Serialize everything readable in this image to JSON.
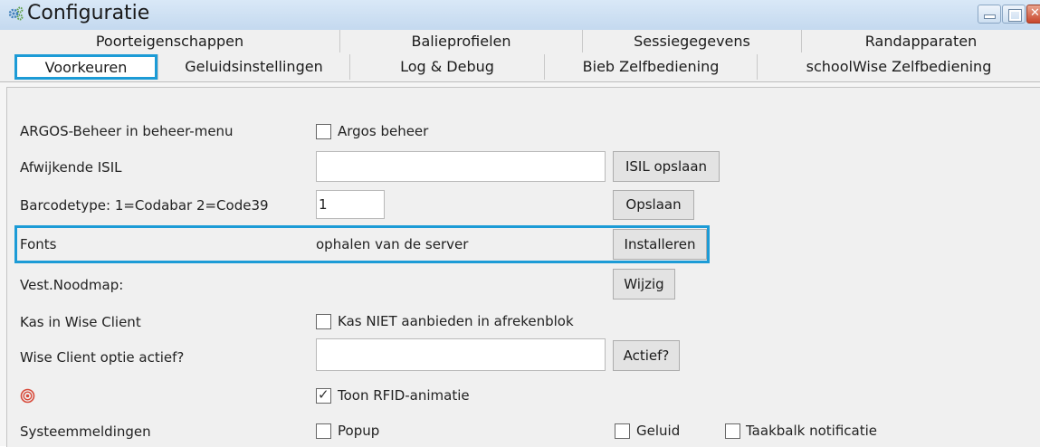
{
  "window": {
    "title": "Configuratie",
    "icon": "gears-icon",
    "controls": [
      "minimize",
      "maximize",
      "close"
    ]
  },
  "tabs": {
    "row1": [
      "Poorteigenschappen",
      "Balieprofielen",
      "Sessiegegevens",
      "Randapparaten"
    ],
    "row2": [
      "Voorkeuren",
      "Geluidsinstellingen",
      "Log & Debug",
      "Bieb Zelfbediening",
      "schoolWise Zelfbediening"
    ],
    "active": "Voorkeuren"
  },
  "settings": {
    "argos": {
      "label": "ARGOS-Beheer in beheer-menu",
      "checkbox": "Argos beheer",
      "checked": false
    },
    "isil": {
      "label": "Afwijkende ISIL",
      "value": "",
      "button": "ISIL opslaan"
    },
    "barcode": {
      "label": "Barcodetype: 1=Codabar 2=Code39",
      "value": "1",
      "button": "Opslaan"
    },
    "fonts": {
      "label": "Fonts",
      "info": "ophalen van de server",
      "button": "Installeren"
    },
    "noodmap": {
      "label": "Vest.Noodmap:",
      "button": "Wijzig"
    },
    "kas": {
      "label": "Kas in Wise Client",
      "checkbox": "Kas NIET aanbieden in afrekenblok",
      "checked": false
    },
    "wiseclient": {
      "label": "Wise Client optie actief?",
      "value": "",
      "button": "Actief?"
    },
    "rfid": {
      "icon": "rfid-target-icon",
      "checkbox": "Toon RFID-animatie",
      "checked": true
    },
    "meldingen": {
      "label": "Systeemmeldingen",
      "popup": "Popup",
      "popup_checked": false,
      "geluid": "Geluid",
      "geluid_checked": false,
      "taakbalk": "Taakbalk notificatie",
      "taakbalk_checked": false
    }
  },
  "colors": {
    "highlight": "#1c9bd6",
    "titlebar": "#c4d9ef",
    "close": "#c8462b"
  }
}
